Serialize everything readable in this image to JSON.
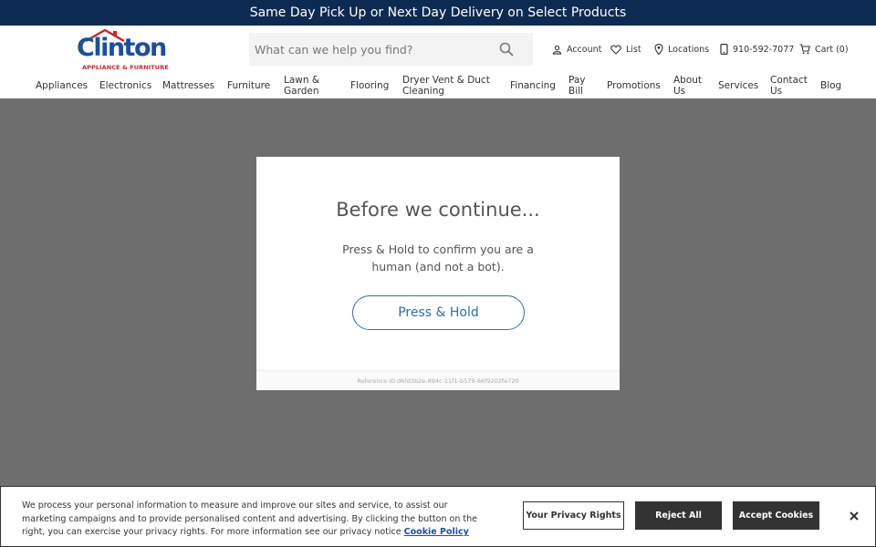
{
  "promo": {
    "text": "Same Day Pick Up or Next Day Delivery on Select Products"
  },
  "logo": {
    "name": "Clinton",
    "tagline": "APPLIANCE & FURNITURE"
  },
  "search": {
    "placeholder": "What can we help you find?",
    "icon": "search-icon"
  },
  "utility": {
    "account": "Account",
    "list": "List",
    "locations": "Locations",
    "phone": "910-592-7077",
    "cart": "Cart (0)"
  },
  "nav": {
    "items": [
      {
        "label": "Appliances"
      },
      {
        "label": "Electronics"
      },
      {
        "label": "Mattresses"
      },
      {
        "label": "Furniture"
      },
      {
        "label": "Lawn & Garden"
      },
      {
        "label": "Flooring"
      },
      {
        "label": "Dryer Vent & Duct Cleaning"
      },
      {
        "label": "Financing"
      },
      {
        "label": "Pay Bill"
      },
      {
        "label": "Promotions"
      },
      {
        "label": "About Us"
      },
      {
        "label": "Services"
      },
      {
        "label": "Contact Us"
      },
      {
        "label": "Blog"
      }
    ]
  },
  "modal": {
    "title": "Before we continue...",
    "text": "Press & Hold to confirm you are a human (and not a bot).",
    "button": "Press & Hold",
    "reference": "Reference ID d6fd3b2e-894c-11f1-b579-66f9202fe720"
  },
  "cookie": {
    "text": "We process your personal information to measure and improve our sites and service, to assist our marketing campaigns and to provide personalised content and advertising. By clicking the button on the right, you can exercise your privacy rights. For more information see our privacy notice",
    "link": "Cookie Policy",
    "privacy_button": "Your Privacy Rights",
    "reject_button": "Reject All",
    "accept_button": "Accept Cookies"
  },
  "colors": {
    "promo_bg": "#0d2a52",
    "brand_blue": "#1c4f9c",
    "brand_red": "#c8272d",
    "overlay": "#6e6e6e",
    "button_blue": "#2a6fb2"
  }
}
